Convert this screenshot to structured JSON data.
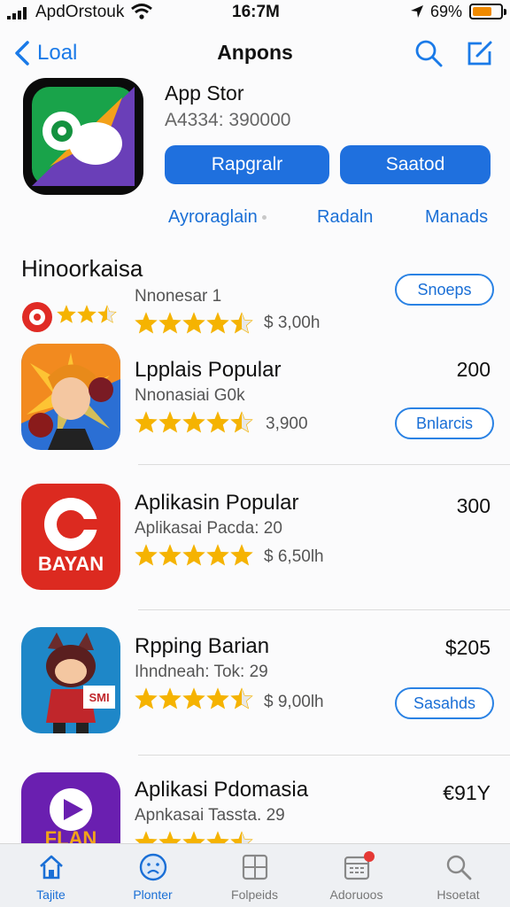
{
  "status_bar": {
    "carrier": "ApdOrstouk",
    "time": "16:7M",
    "battery": "69%",
    "battery_level": 0.69
  },
  "nav": {
    "back_label": "Loal",
    "title": "Anpons"
  },
  "hero": {
    "name": "App Stor",
    "subtitle": "A4334: 390000",
    "button_primary": "Rapgralr",
    "button_secondary": "Saatod"
  },
  "segments": [
    "Ayroraglain",
    "Radaln",
    "Manads"
  ],
  "section_title": "Hinoorkaisa",
  "apps": [
    {
      "name": "",
      "subtitle": "Nnonesar 1",
      "meta": "$ 3,00h",
      "price": "",
      "action": "Snoeps",
      "rating": 3.5,
      "icon": "red-chat-icon"
    },
    {
      "name": "Lpplais Popular",
      "subtitle": "Nnonasiai G0k",
      "meta": "3,900",
      "price": "200",
      "action": "Bnlarcis",
      "rating": 4.5,
      "icon": "hero-game-icon"
    },
    {
      "name": "Aplikasin Popular",
      "subtitle": "Aplikasai Pacda: 20",
      "meta": "$ 6,50lh",
      "price": "300",
      "action": "",
      "rating": 5,
      "icon": "bayan-icon"
    },
    {
      "name": "Rpping Barian",
      "subtitle": "Ihndneah: Tok: 29",
      "meta": "$ 9,00lh",
      "price": "$205",
      "action": "Sasahds",
      "rating": 4.5,
      "icon": "ninja-game-icon"
    },
    {
      "name": "Aplikasi Pdomasia",
      "subtitle": "Apnkasai Tassta. 29",
      "meta": "",
      "price": "€91Y",
      "action": "",
      "rating": 4.5,
      "icon": "flan-play-icon"
    }
  ],
  "icon_texts": {
    "bayan": "BAYAN",
    "flan": "FLAN",
    "sign": "SMI"
  },
  "tabs": [
    {
      "label": "Tajite",
      "icon": "home-icon",
      "active": true
    },
    {
      "label": "Plonter",
      "icon": "face-icon",
      "active": true
    },
    {
      "label": "Folpeids",
      "icon": "grid-icon",
      "active": false
    },
    {
      "label": "Adoruoos",
      "icon": "calendar-icon",
      "active": false
    },
    {
      "label": "Hsoetat",
      "icon": "search-icon",
      "active": false
    }
  ],
  "colors": {
    "accent": "#1f70de",
    "star": "#f5b301",
    "badge": "#e53935"
  }
}
